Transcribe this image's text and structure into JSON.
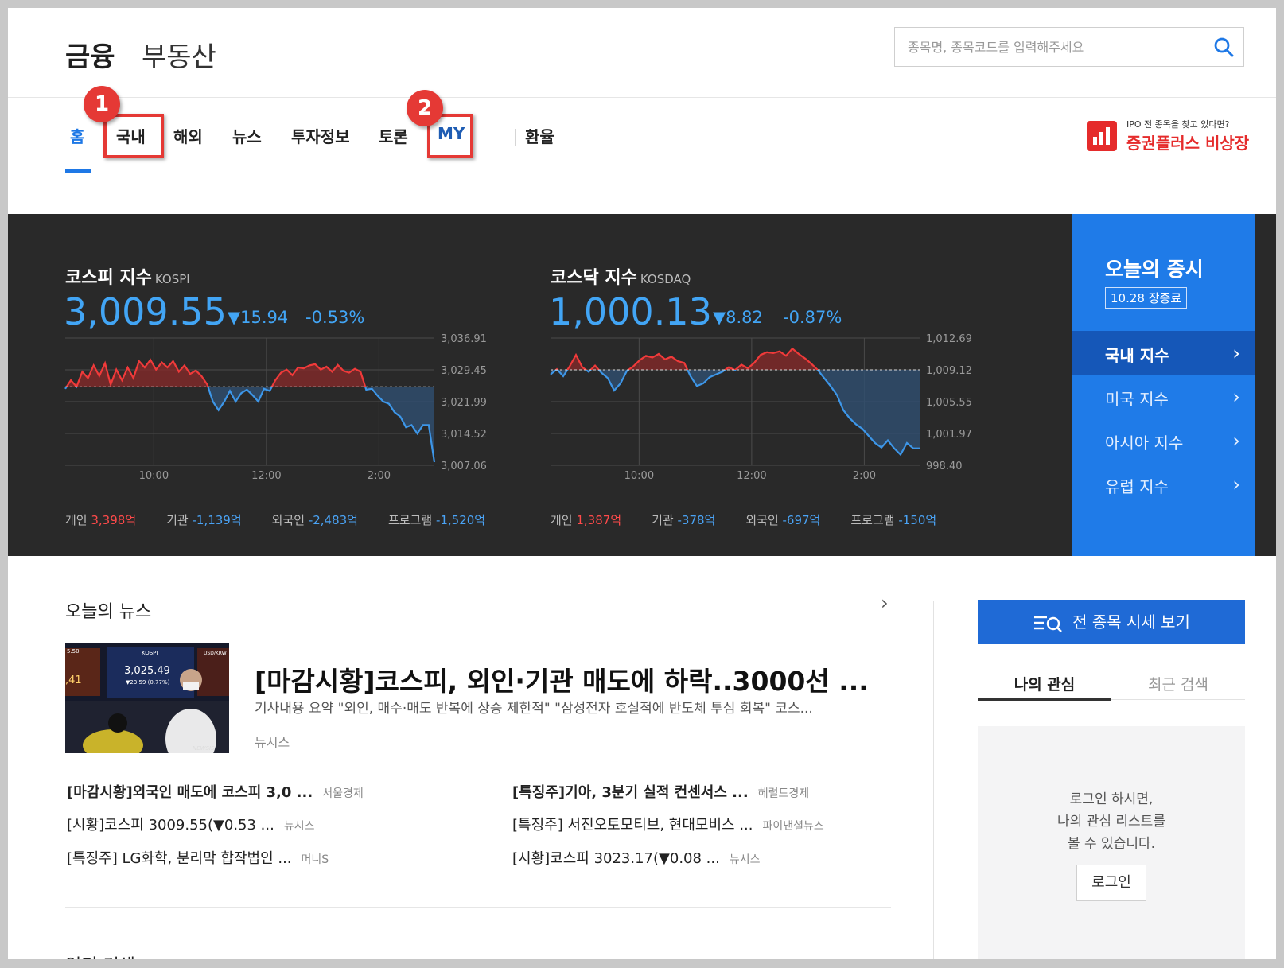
{
  "header": {
    "brand_finance": "금융",
    "brand_realestate": "부동산",
    "search_placeholder": "종목명, 종목코드를 입력해주세요"
  },
  "nav": {
    "items": [
      "홈",
      "국내",
      "해외",
      "뉴스",
      "투자정보",
      "토론",
      "MY",
      "환율"
    ],
    "active_index": 0
  },
  "annotations": {
    "badge1": "1",
    "badge2": "2",
    "color": "#e53935"
  },
  "ad": {
    "small": "IPO 전 종목을 찾고 있다면?",
    "big": "증권플러스 비상장"
  },
  "market": {
    "kospi": {
      "name": "코스피 지수",
      "name_en": "KOSPI",
      "value": "3,009.55",
      "change": "▼15.94",
      "pct": "-0.53%",
      "flows": [
        {
          "label": "개인",
          "value": "3,398억",
          "color": "red"
        },
        {
          "label": "기관",
          "value": "-1,139억",
          "color": "blue"
        },
        {
          "label": "외국인",
          "value": "-2,483억",
          "color": "blue"
        },
        {
          "label": "프로그램",
          "value": "-1,520억",
          "color": "blue"
        }
      ]
    },
    "kosdaq": {
      "name": "코스닥 지수",
      "name_en": "KOSDAQ",
      "value": "1,000.13",
      "change": "▼8.82",
      "pct": "-0.87%",
      "flows": [
        {
          "label": "개인",
          "value": "1,387억",
          "color": "red"
        },
        {
          "label": "기관",
          "value": "-378억",
          "color": "blue"
        },
        {
          "label": "외국인",
          "value": "-697억",
          "color": "blue"
        },
        {
          "label": "프로그램",
          "value": "-150억",
          "color": "blue"
        }
      ]
    },
    "today": {
      "title": "오늘의 증시",
      "date": "10.28 장종료",
      "items": [
        "국내 지수",
        "미국 지수",
        "아시아 지수",
        "유럽 지수"
      ],
      "active_index": 0
    }
  },
  "chart_data": [
    {
      "type": "line",
      "name": "KOSPI",
      "x_ticks": [
        "10:00",
        "12:00",
        "2:00"
      ],
      "y_ticks": [
        "3,036.91",
        "3,029.45",
        "3,021.99",
        "3,014.52",
        "3,007.06"
      ],
      "ylim": [
        3007.06,
        3036.91
      ],
      "baseline": 3025.49,
      "series": [
        3025,
        3027,
        3025.5,
        3029,
        3027.5,
        3030.5,
        3028,
        3031,
        3026,
        3029.5,
        3027,
        3030,
        3027.5,
        3031.5,
        3030,
        3031.8,
        3029.5,
        3031.2,
        3030,
        3031.5,
        3029,
        3030.5,
        3028.5,
        3029.3,
        3028,
        3026,
        3022,
        3020,
        3022,
        3024.5,
        3022,
        3024,
        3024.8,
        3023.5,
        3022,
        3025,
        3024.5,
        3027,
        3028.8,
        3029.5,
        3028.2,
        3030,
        3029.8,
        3030.5,
        3030.8,
        3029.5,
        3030.2,
        3029,
        3030.6,
        3029.2,
        3028.8,
        3029.7,
        3029,
        3024.8,
        3025,
        3023.4,
        3022,
        3021.5,
        3019.5,
        3018.5,
        3016,
        3016.5,
        3014.5,
        3016.5,
        3016.5,
        3007.8
      ],
      "colors": {
        "up": "#f03a3a",
        "down": "#3d96e8"
      }
    },
    {
      "type": "line",
      "name": "KOSDAQ",
      "x_ticks": [
        "10:00",
        "12:00",
        "2:00"
      ],
      "y_ticks": [
        "1,012.69",
        "1,009.12",
        "1,005.55",
        "1,001.97",
        "998.40"
      ],
      "ylim": [
        998.4,
        1012.69
      ],
      "baseline": 1009.12,
      "series": [
        1008.6,
        1009.2,
        1008.4,
        1009.5,
        1010.8,
        1009.4,
        1008.9,
        1009.6,
        1008.8,
        1008.2,
        1006.8,
        1007.6,
        1009.0,
        1009.5,
        1010.2,
        1010.7,
        1010.5,
        1010.9,
        1010.3,
        1010.6,
        1010.1,
        1009.9,
        1008.4,
        1007.3,
        1007.6,
        1008.3,
        1008.6,
        1008.9,
        1009.4,
        1009.1,
        1009.7,
        1009.3,
        1009.9,
        1010.8,
        1011.1,
        1011.0,
        1011.2,
        1010.7,
        1011.5,
        1010.9,
        1010.4,
        1009.8,
        1009.1,
        1008.2,
        1007.3,
        1006.3,
        1004.6,
        1003.7,
        1003.0,
        1002.5,
        1001.7,
        1000.9,
        1000.4,
        1001.2,
        1000.3,
        999.6,
        1000.9,
        1000.3,
        1000.3
      ],
      "colors": {
        "up": "#f03a3a",
        "down": "#3d96e8"
      }
    }
  ],
  "news": {
    "section_title": "오늘의 뉴스",
    "more": "›",
    "headline": "[마감시황]코스피, 외인·기관 매도에 하락..3000선 ...",
    "summary": "기사내용 요약 \"외인, 매수·매도 반복에 상승 제한적\" \"삼성전자 호실적에 반도체 투심 회복\" 코스...",
    "source": "뉴시스",
    "thumb_texts": {
      "kospi": "KOSPI",
      "value": "3,025.49",
      "chg": "▼23.59 (0.77%)",
      "usd": "USD/KRW",
      "left": "5.50",
      "left2": ",41",
      "right": "NEWSIS"
    },
    "links_left": [
      {
        "title": "[마감시황]외국인 매도에 코스피 3,0 ...",
        "source": "서울경제",
        "bold": true
      },
      {
        "title": "[시황]코스피 3009.55(▼0.53 ...",
        "source": "뉴시스",
        "bold": false
      },
      {
        "title": "[특징주] LG화학, 분리막 합작법인 ...",
        "source": "머니S",
        "bold": false
      }
    ],
    "links_right": [
      {
        "title": "[특징주]기아, 3분기 실적 컨센서스 ...",
        "source": "헤럴드경제",
        "bold": true
      },
      {
        "title": "[특징주] 서진오토모티브, 현대모비스 ...",
        "source": "파이낸셜뉴스",
        "bold": false
      },
      {
        "title": "[시황]코스피 3023.17(▼0.08 ...",
        "source": "뉴시스",
        "bold": false
      }
    ],
    "popular_title": "인기 검색"
  },
  "sidebar": {
    "all_stocks_button": "전 종목 시세 보기",
    "tabs": [
      "나의 관심",
      "최근 검색"
    ],
    "login_lines": [
      "로그인 하시면,",
      "나의 관심 리스트를",
      "볼 수 있습니다."
    ],
    "login_button": "로그인"
  }
}
